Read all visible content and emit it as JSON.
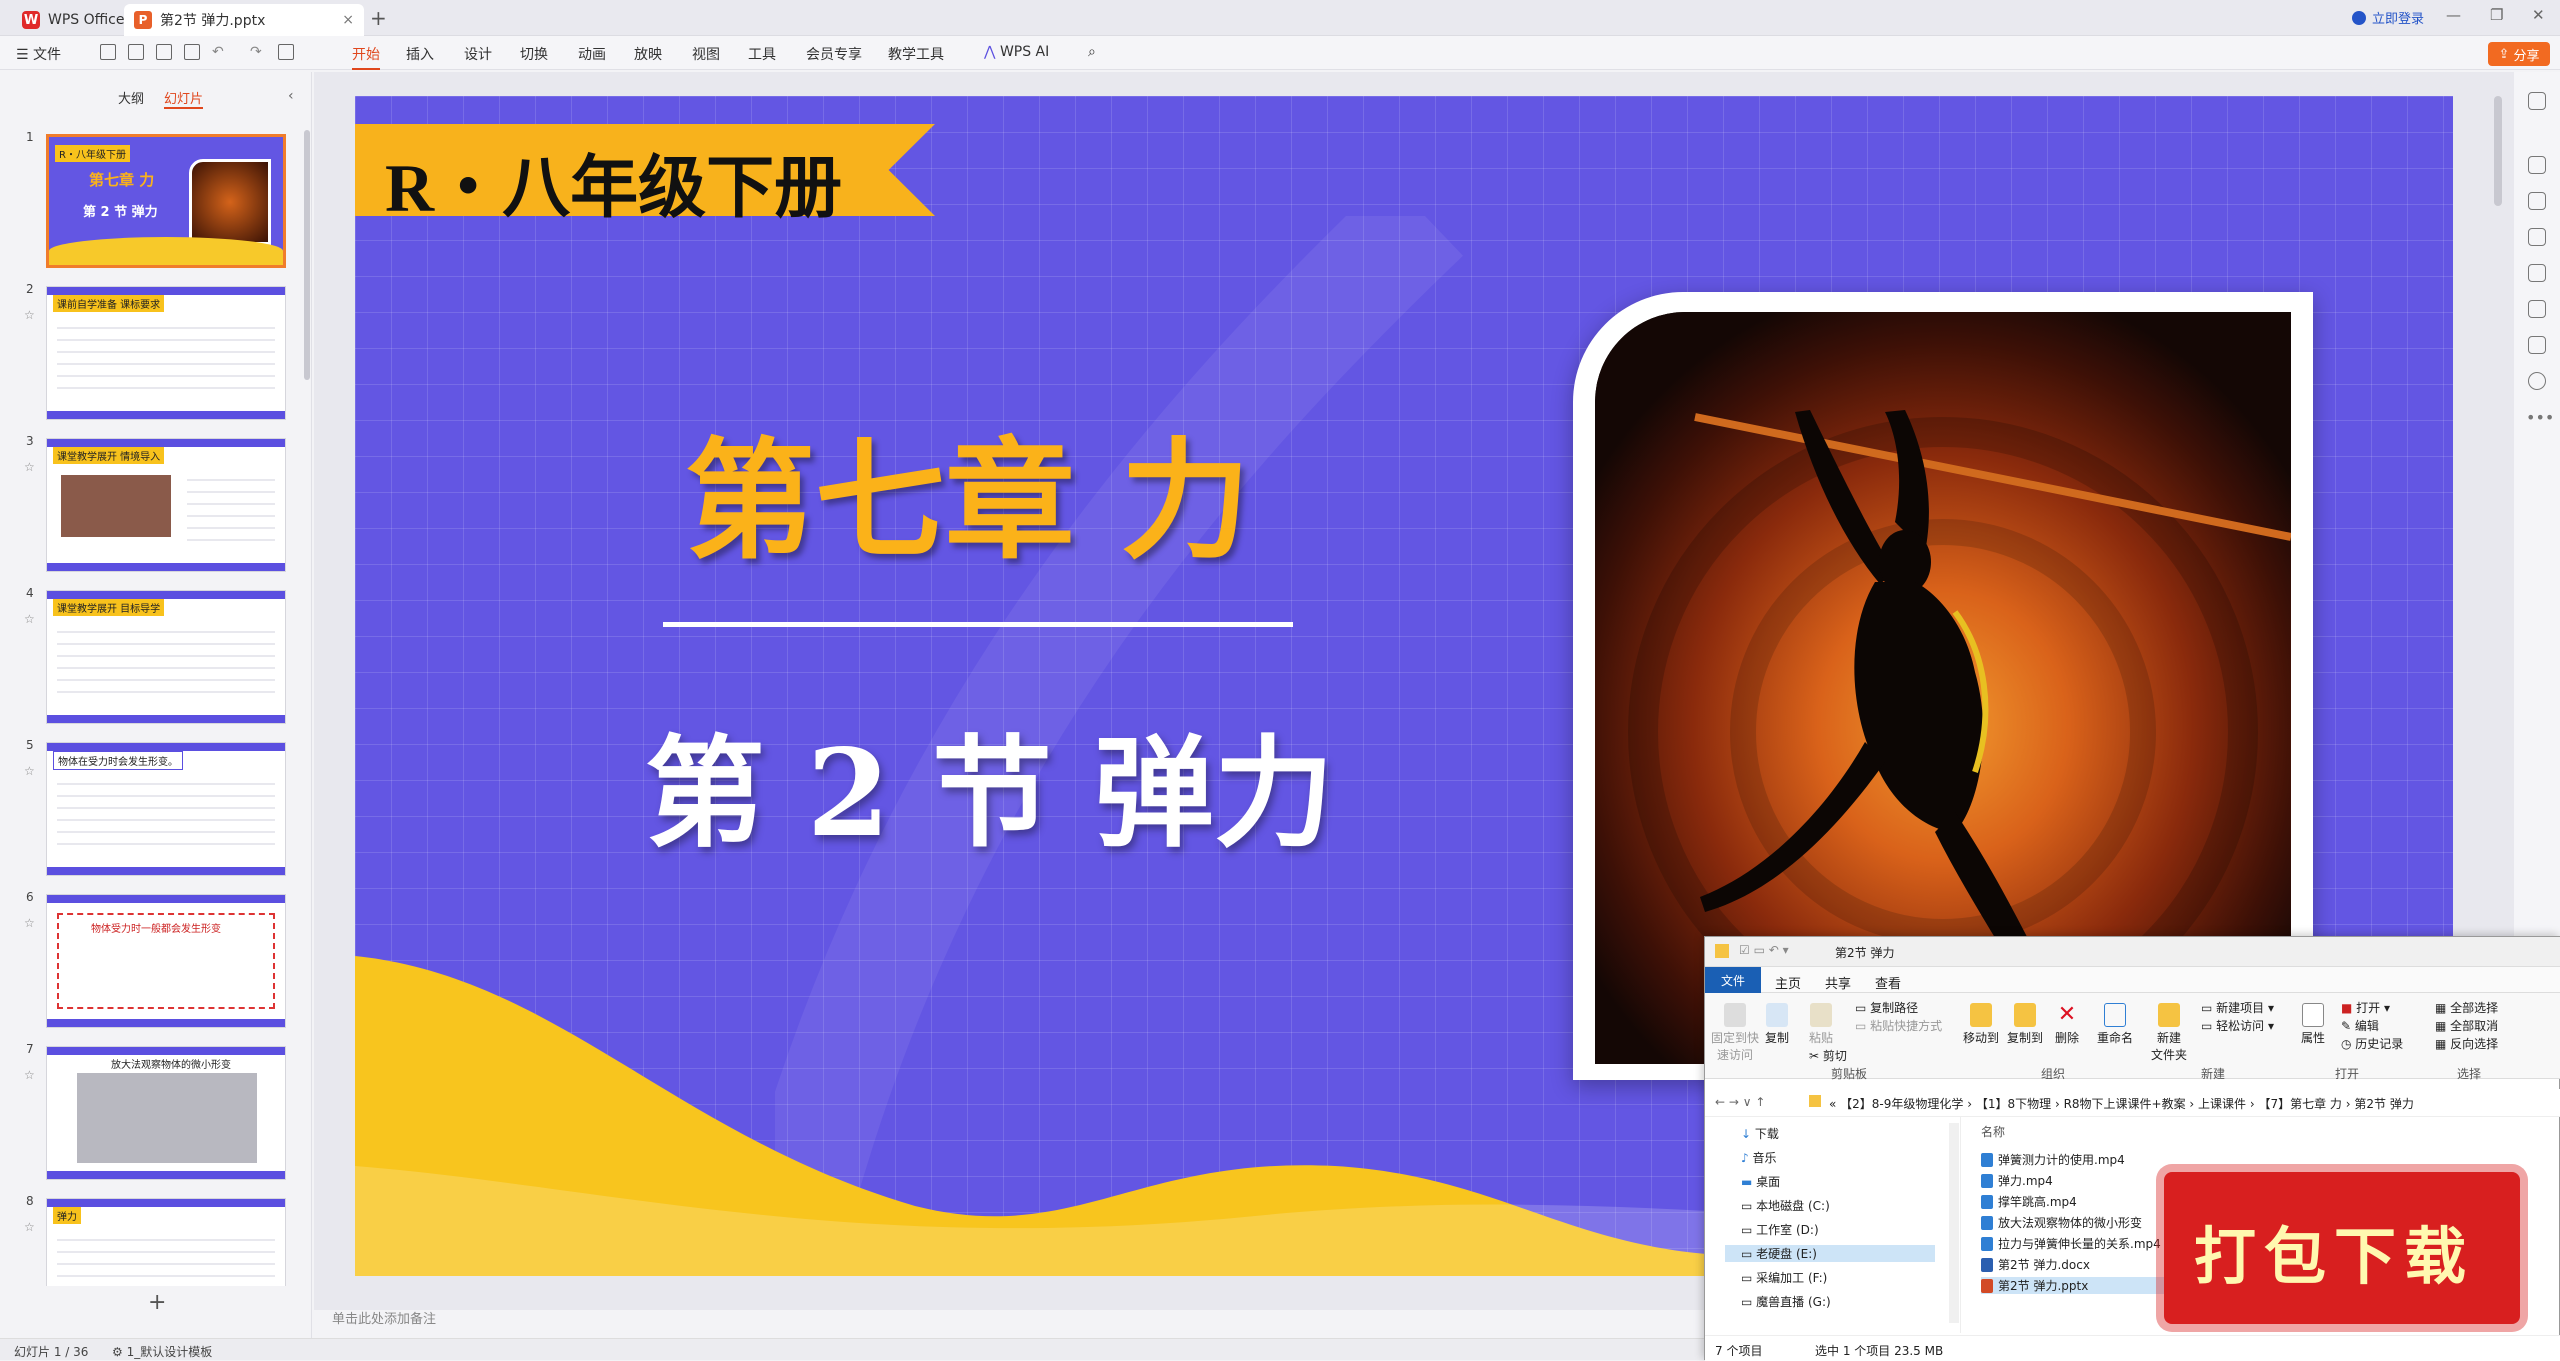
{
  "titlebar": {
    "app_name": "WPS Office",
    "doc_tab": "第2节 弹力.pptx",
    "login": "立即登录"
  },
  "menubar": {
    "file": "文件",
    "tabs": [
      "开始",
      "插入",
      "设计",
      "切换",
      "动画",
      "放映",
      "视图",
      "工具",
      "会员专享",
      "教学工具"
    ],
    "wps_ai": "WPS AI",
    "share": "分享"
  },
  "sidebar": {
    "tab_outline": "大纲",
    "tab_slides": "幻灯片",
    "thumbs": [
      {
        "num": "1",
        "title": "R・八年级下册"
      },
      {
        "num": "2",
        "title": "课前自学准备 课标要求"
      },
      {
        "num": "3",
        "title": "课堂教学展开 情境导入"
      },
      {
        "num": "4",
        "title": "课堂教学展开 目标导学"
      },
      {
        "num": "5",
        "title": "物体在受力时会发生形变。"
      },
      {
        "num": "6",
        "title": "物体受力时一般都会发生形变"
      },
      {
        "num": "7",
        "title": "放大法观察物体的微小形变"
      },
      {
        "num": "8",
        "title": "弹力"
      }
    ]
  },
  "slide": {
    "banner": "R・八年级下册",
    "chapter": "第七章  力",
    "section": "第 2 节  弹力"
  },
  "notes_placeholder": "单击此处添加备注",
  "status": {
    "slide_counter": "幻灯片 1 / 36",
    "template": "1_默认设计模板"
  },
  "explorer": {
    "title": "第2节 弹力",
    "tabs": [
      "文件",
      "主页",
      "共享",
      "查看"
    ],
    "ribbon": {
      "pin": "固定到快\n速访问",
      "copy": "复制",
      "paste": "粘贴",
      "copy_path": "复制路径",
      "paste_shortcut": "粘贴快捷方式",
      "cut": "剪切",
      "move_to": "移动到",
      "copy_to": "复制到",
      "delete": "删除",
      "rename": "重命名",
      "new_folder": "新建\n文件夹",
      "new_item": "新建项目",
      "easy_access": "轻松访问",
      "properties": "属性",
      "open": "打开",
      "edit": "编辑",
      "history": "历史记录",
      "select_all": "全部选择",
      "select_none": "全部取消",
      "invert": "反向选择",
      "groups": [
        "剪贴板",
        "组织",
        "新建",
        "打开",
        "选择"
      ]
    },
    "address": [
      "【2】8-9年级物理化学",
      "【1】8下物理",
      "R8物下上课课件+教案",
      "上课课件",
      "【7】第七章 力",
      "第2节 弹力"
    ],
    "nav": [
      "下载",
      "音乐",
      "桌面",
      "本地磁盘 (C:)",
      "工作室 (D:)",
      "老硬盘 (E:)",
      "采编加工 (F:)",
      "魔兽直播 (G:)"
    ],
    "column_name": "名称",
    "files": [
      {
        "name": "弹簧测力计的使用.mp4",
        "type": "video"
      },
      {
        "name": "弹力.mp4",
        "type": "video"
      },
      {
        "name": "撑竿跳高.mp4",
        "type": "video"
      },
      {
        "name": "放大法观察物体的微小形变",
        "type": "video"
      },
      {
        "name": "拉力与弹簧伸长量的关系.mp4",
        "type": "video"
      },
      {
        "name": "第2节  弹力.docx",
        "type": "doc"
      },
      {
        "name": "第2节  弹力.pptx",
        "type": "ppt"
      }
    ],
    "status_items": "7 个项目",
    "status_selected": "选中 1 个项目 23.5 MB"
  },
  "stamp": "打包下载",
  "colors": {
    "slide_bg": "#6356e3",
    "banner": "#f8b21c",
    "chapter_text": "#fbb219",
    "accent": "#e0471d"
  }
}
